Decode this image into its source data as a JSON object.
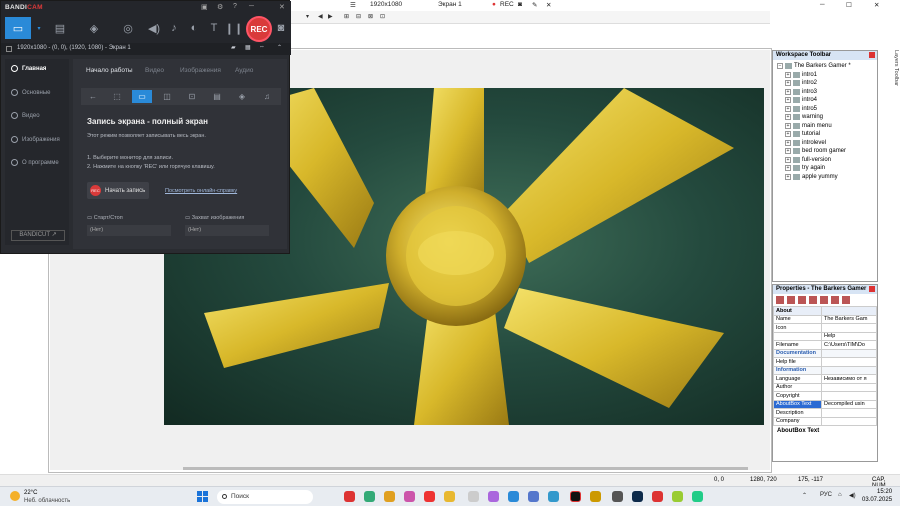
{
  "ide": {
    "titlebar": {
      "resolution": "1920x1080",
      "screen_name": "Экран 1",
      "rec_label": "REC"
    },
    "workspace": {
      "title": "Workspace Toolbar",
      "root": "The Barkers Gamer *",
      "items": [
        "intro1",
        "intro2",
        "intro3",
        "intro4",
        "intro5",
        "warning",
        "main menu",
        "tutorial",
        "introlevel",
        "bed room gamer",
        "full-version",
        "try again",
        "apple yummy"
      ]
    },
    "properties": {
      "title": "Properties - The Barkers Gamer",
      "rows": [
        {
          "type": "cat",
          "label": "About",
          "value": ""
        },
        {
          "type": "row",
          "label": "Name",
          "value": "The Barkers Gam"
        },
        {
          "type": "row",
          "label": "Icon",
          "value": ""
        },
        {
          "type": "row",
          "label": "",
          "value": "Help"
        },
        {
          "type": "row",
          "label": "Filename",
          "value": "C:\\Users\\TIM\\Do"
        },
        {
          "type": "cat2",
          "label": "Documentation",
          "value": ""
        },
        {
          "type": "row",
          "label": "Help file",
          "value": ""
        },
        {
          "type": "cat2",
          "label": "Information",
          "value": ""
        },
        {
          "type": "row",
          "label": "Language",
          "value": "Независимо от я"
        },
        {
          "type": "row",
          "label": "Author",
          "value": ""
        },
        {
          "type": "row",
          "label": "Copyright",
          "value": ""
        },
        {
          "type": "sel",
          "label": "AboutBox Text",
          "value": "Decompiled usin"
        },
        {
          "type": "row",
          "label": "Description",
          "value": ""
        },
        {
          "type": "row",
          "label": "Company",
          "value": ""
        }
      ],
      "description_title": "AboutBox Text"
    },
    "side_tab": "Layers Toolbar",
    "status": {
      "pos1": "0, 0",
      "pos2": "1280, 720",
      "pos3": "175, -117",
      "caps": "CAP, NUM"
    }
  },
  "bandicam": {
    "logo_a": "BANDI",
    "logo_b": "CAM",
    "rec_label": "REC",
    "info": "1920x1080 - (0, 0), (1920, 1080) - Экран 1",
    "nav": [
      "Главная",
      "Основные",
      "Видео",
      "Изображения",
      "О программе"
    ],
    "bandicut": "BANDICUT ↗",
    "tabs": [
      "Начало работы",
      "Видео",
      "Изображения",
      "Аудио"
    ],
    "heading": "Запись экрана - полный экран",
    "desc": "Этот режим позволяет записывать весь экран.",
    "step1": "1. Выберите монитор для записи.",
    "step2": "2. Нажмите на кнопку 'REC' или горячую клавишу.",
    "start_label": "Начать запись",
    "start_rec": "REC",
    "help_link": "Посмотреть онлайн-справку",
    "hotkey_start_label": "Старт/Стоп",
    "hotkey_start_value": "(Нет)",
    "hotkey_capture_label": "Захват изображения",
    "hotkey_capture_value": "(Нет)"
  },
  "taskbar": {
    "temp": "22°C",
    "weather": "Неб. облачность",
    "search": "Поиск",
    "lang": "РУС",
    "time": "15:20",
    "date": "03.07.2025"
  },
  "colors": {
    "accent": "#2a8ad8",
    "rec": "#d93a3a"
  },
  "icons": [
    "monitor-icon",
    "game-icon",
    "webcam-icon",
    "mic-icon",
    "speaker-icon",
    "camera-icon",
    "pause-icon"
  ]
}
